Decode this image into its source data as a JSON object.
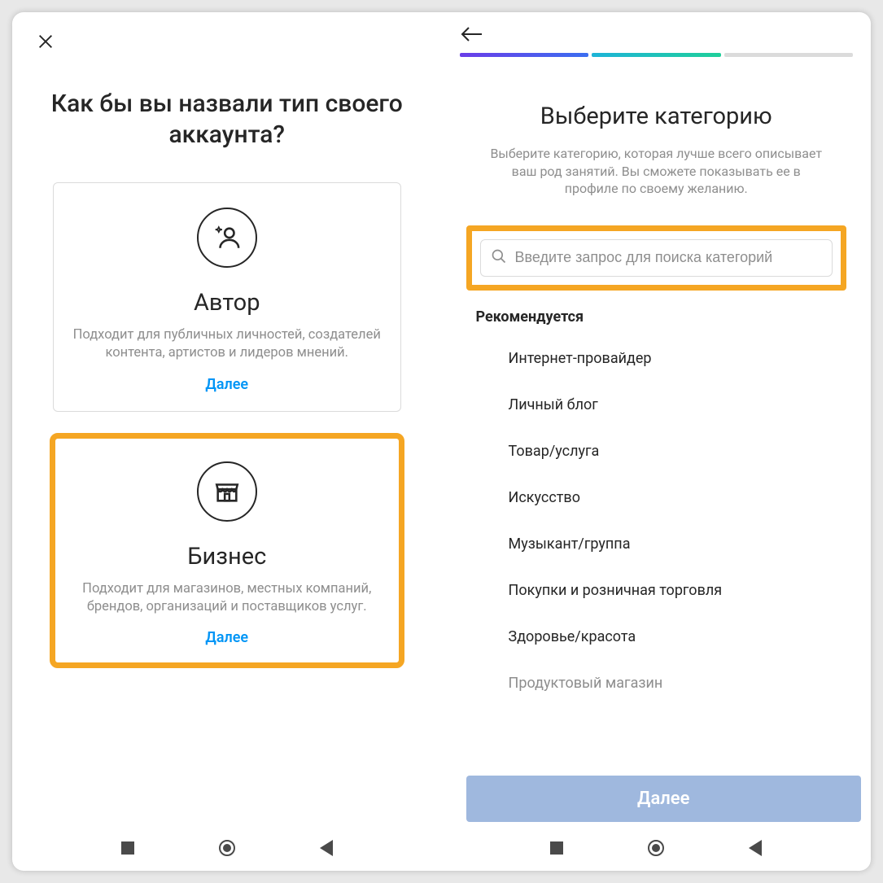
{
  "left": {
    "heading": "Как бы вы назвали тип своего аккаунта?",
    "cards": [
      {
        "title": "Автор",
        "desc": "Подходит для публичных личностей, создателей контента, артистов и лидеров мнений.",
        "action": "Далее"
      },
      {
        "title": "Бизнес",
        "desc": "Подходит для магазинов, местных компаний, брендов, организаций и поставщиков услуг.",
        "action": "Далее"
      }
    ]
  },
  "right": {
    "heading": "Выберите категорию",
    "subtitle": "Выберите категорию, которая лучше всего описывает ваш род занятий. Вы сможете показывать ее в профиле по своему желанию.",
    "search_placeholder": "Введите запрос для поиска категорий",
    "recommended_label": "Рекомендуется",
    "categories": [
      "Интернет-провайдер",
      "Личный блог",
      "Товар/услуга",
      "Искусство",
      "Музыкант/группа",
      "Покупки и розничная торговля",
      "Здоровье/красота",
      "Продуктовый магазин"
    ],
    "next_button": "Далее"
  }
}
